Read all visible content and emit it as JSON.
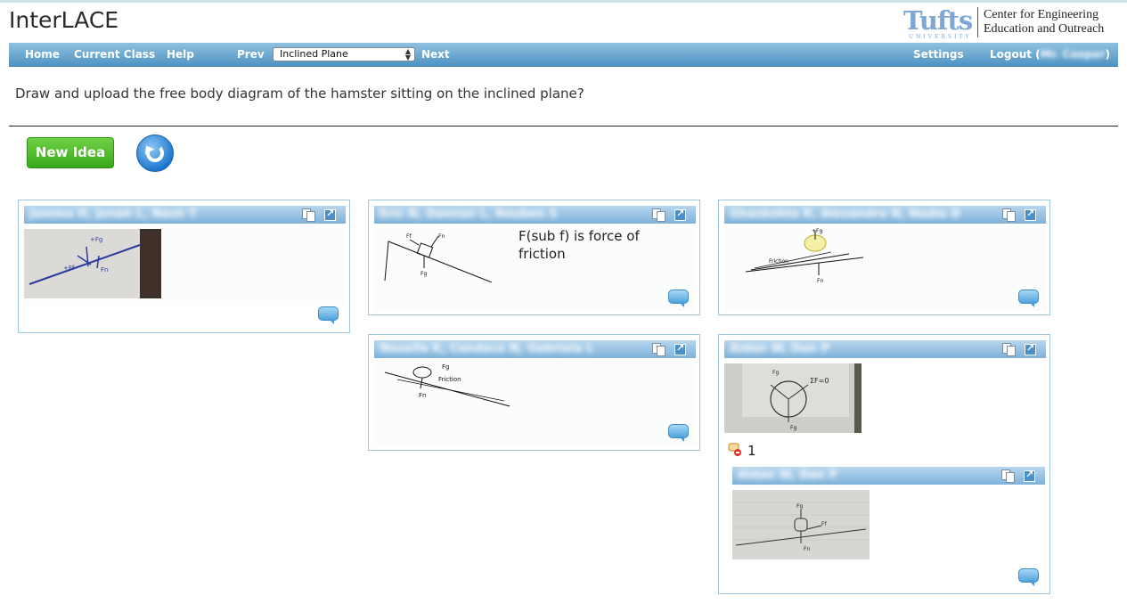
{
  "app": {
    "title": "InterLACE"
  },
  "logo": {
    "tufts": "Tufts",
    "university": "UNIVERSITY",
    "center_line1": "Center for Engineering",
    "center_line2": "Education and Outreach"
  },
  "nav": {
    "home": "Home",
    "current_class": "Current Class",
    "help": "Help",
    "prev": "Prev",
    "selected_page": "Inclined Plane",
    "next": "Next",
    "settings": "Settings",
    "logout": "Logout (",
    "logout_user": "Mr. Cooper",
    "logout_close": ")"
  },
  "question": "Draw and upload the free body diagram of the hamster sitting on the inclined plane?",
  "toolbar": {
    "new_idea": "New Idea"
  },
  "colors": {
    "nav_top": "#8fc1e0",
    "nav_bottom": "#4f93c3",
    "new_idea_green": "#3aa81c",
    "card_border": "#9fc6e0",
    "header_blue": "#7fb2da"
  },
  "ideas": [
    {
      "author": "Jamma H, Jonah L, Nash T",
      "text": "",
      "has_photo": true
    },
    {
      "author": "Eric N, Damian L, Reuben S",
      "text_line1": "F(sub f) is force of",
      "text_line2": "friction",
      "has_photo": false
    },
    {
      "author": "Ghaskohta R, Alexandra N, Nadia D",
      "text": "",
      "has_photo": false
    },
    {
      "author": "Nazalfa K, Candace N, Gabriela L",
      "text": "",
      "has_photo": false
    },
    {
      "author": "Aidan W, Dan P",
      "text": "",
      "has_photo": true,
      "reply_count": "1",
      "reply": {
        "author": "Aidan W, Dan P",
        "has_photo": true
      }
    }
  ],
  "icons": {
    "copy": "copy-icon",
    "open": "open-external-icon",
    "comment": "comment-bubble-icon",
    "refresh": "refresh-icon",
    "reply": "reply-icon"
  }
}
